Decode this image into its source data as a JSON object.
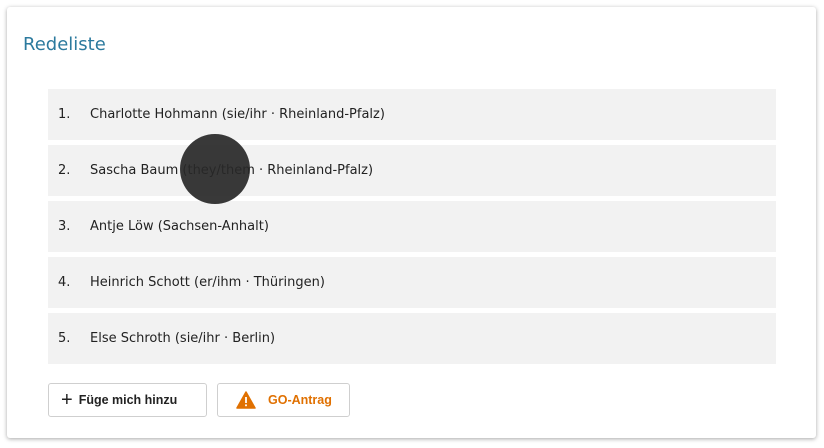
{
  "title": "Redeliste",
  "speakers": [
    {
      "number": "1.",
      "name": "Charlotte Hohmann (sie/ihr · Rheinland-Pfalz)"
    },
    {
      "number": "2.",
      "name": "Sascha Baum (they/them · Rheinland-Pfalz)"
    },
    {
      "number": "3.",
      "name": "Antje Löw (Sachsen-Anhalt)"
    },
    {
      "number": "4.",
      "name": "Heinrich Schott (er/ihm · Thüringen)"
    },
    {
      "number": "5.",
      "name": "Else Schroth (sie/ihr · Berlin)"
    }
  ],
  "actions": {
    "add_label": "Füge mich hinzu",
    "go_label": "GO-Antrag",
    "add_icon": "plus-icon",
    "go_icon": "warning-icon"
  },
  "colors": {
    "title": "#2c7a9e",
    "go_accent": "#e07000",
    "row_bg": "#f2f2f2"
  }
}
